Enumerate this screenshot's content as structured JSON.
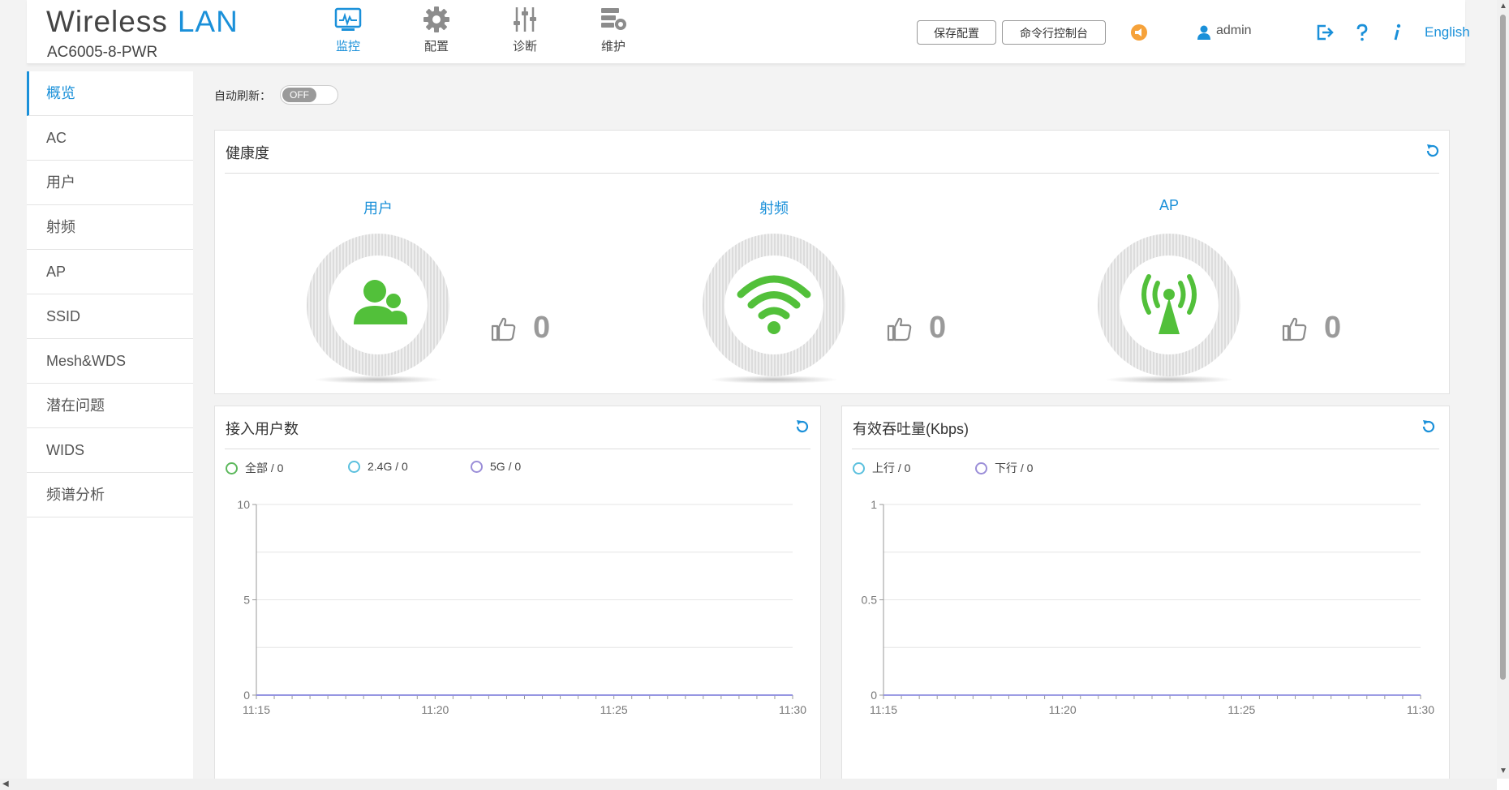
{
  "header": {
    "logo_wireless": "Wireless",
    "logo_lan": "LAN",
    "model": "AC6005-8-PWR",
    "nav": [
      {
        "label": "监控",
        "icon": "monitor-icon",
        "active": true
      },
      {
        "label": "配置",
        "icon": "gear-icon",
        "active": false
      },
      {
        "label": "诊断",
        "icon": "sliders-icon",
        "active": false
      },
      {
        "label": "维护",
        "icon": "maintenance-icon",
        "active": false
      }
    ],
    "save_config": "保存配置",
    "cli_console": "命令行控制台",
    "user": "admin",
    "language": "English"
  },
  "sidebar": {
    "items": [
      "概览",
      "AC",
      "用户",
      "射频",
      "AP",
      "SSID",
      "Mesh&WDS",
      "潜在问题",
      "WIDS",
      "频谱分析"
    ],
    "active_index": 0
  },
  "auto_refresh": {
    "label": "自动刷新：",
    "state": "OFF"
  },
  "health": {
    "title": "健康度",
    "items": [
      {
        "label": "用户",
        "icon": "users-icon",
        "score": "0"
      },
      {
        "label": "射频",
        "icon": "wifi-icon",
        "score": "0"
      },
      {
        "label": "AP",
        "icon": "antenna-icon",
        "score": "0"
      }
    ]
  },
  "users_panel": {
    "title": "接入用户数",
    "legend": [
      {
        "label": "全部 / 0",
        "color": "#5cb85c"
      },
      {
        "label": "2.4G / 0",
        "color": "#5bc0de"
      },
      {
        "label": "5G / 0",
        "color": "#9b8ed8"
      }
    ]
  },
  "throughput_panel": {
    "title": "有效吞吐量(Kbps)",
    "legend": [
      {
        "label": "上行 / 0",
        "color": "#5bc0de"
      },
      {
        "label": "下行 / 0",
        "color": "#9b8ed8"
      }
    ]
  },
  "chart_data": [
    {
      "type": "line",
      "title": "接入用户数",
      "x_ticks": [
        "11:15",
        "11:20",
        "11:25",
        "11:30"
      ],
      "y_ticks": [
        "0",
        "5",
        "10"
      ],
      "ylim": [
        0,
        10
      ],
      "series": [
        {
          "name": "全部",
          "values": [
            0,
            0,
            0,
            0
          ]
        },
        {
          "name": "2.4G",
          "values": [
            0,
            0,
            0,
            0
          ]
        },
        {
          "name": "5G",
          "values": [
            0,
            0,
            0,
            0
          ]
        }
      ],
      "grid": true
    },
    {
      "type": "line",
      "title": "有效吞吐量(Kbps)",
      "x_ticks": [
        "11:15",
        "11:20",
        "11:25",
        "11:30"
      ],
      "y_ticks": [
        "0",
        "0.5",
        "1"
      ],
      "ylim": [
        0,
        1
      ],
      "series": [
        {
          "name": "上行",
          "values": [
            0,
            0,
            0,
            0
          ]
        },
        {
          "name": "下行",
          "values": [
            0,
            0,
            0,
            0
          ]
        }
      ],
      "grid": true
    }
  ],
  "colors": {
    "accent": "#1a90d9",
    "health_green": "#52c03a",
    "line": "#8f8fe0"
  }
}
